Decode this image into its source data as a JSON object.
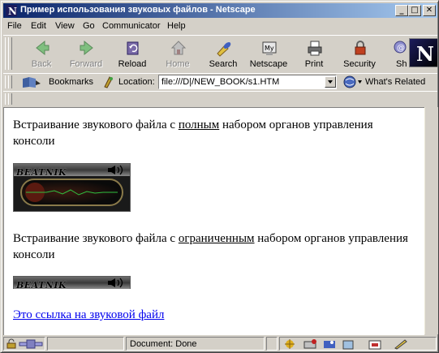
{
  "window": {
    "title": "Пример использования звуковых файлов - Netscape",
    "controls": {
      "minimize": "_",
      "maximize": "□",
      "close": "✕"
    }
  },
  "menu": [
    {
      "label": "File",
      "icon": "none"
    },
    {
      "label": "Edit"
    },
    {
      "label": "View"
    },
    {
      "label": "Go"
    },
    {
      "label": "Communicator"
    },
    {
      "label": "Help"
    }
  ],
  "toolbar": {
    "back": "Back",
    "forward": "Forward",
    "reload": "Reload",
    "home": "Home",
    "search": "Search",
    "netscape": "Netscape",
    "print": "Print",
    "security": "Security",
    "shop": "Sh",
    "logo_letter": "N"
  },
  "location_bar": {
    "bookmarks": "Bookmarks",
    "location_label": "Location:",
    "url": "file:///D|/NEW_BOOK/s1.HTM",
    "whats_related": "What's Related"
  },
  "page": {
    "para1_before": "Встраивание звукового файла с ",
    "para1_underlined": "полным",
    "para1_after": " набором органов управления консоли",
    "player_logo": "BEATNIK",
    "para2_before": "Встраивание звукового файла с ",
    "para2_underlined": "ограниченным",
    "para2_after": " набором органов управления консоли",
    "link_text": "Это ссылка на звуковой файл "
  },
  "statusbar": {
    "text": "Document: Done"
  },
  "colors": {
    "titlebar_start": "#0a246a",
    "titlebar_end": "#a6caf0",
    "link": "#0000ee",
    "chrome": "#d4d0c8"
  }
}
